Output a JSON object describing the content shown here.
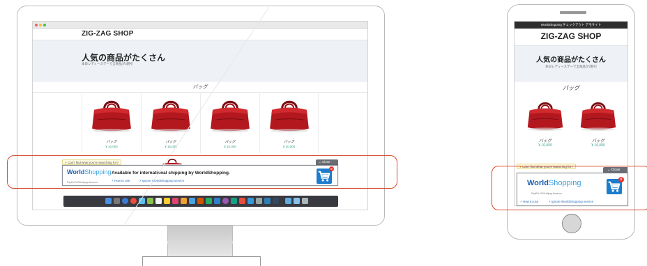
{
  "colors": {
    "highlight": "#d9462b",
    "price": "#35a08c",
    "cart": "#1b7ccd",
    "badge": "#e8312c",
    "link": "#2a6fb8",
    "bag": "#b3181f"
  },
  "desktop": {
    "shop_name": "ZIG-ZAG SHOP",
    "hero_title": "人気の商品がたくさん",
    "hero_sub": "本日レディースデーで全商品が3割引",
    "section_title": "バッグ",
    "products": [
      {
        "name": "バッグ",
        "price": "¥ 10,000"
      },
      {
        "name": "バッグ",
        "price": "¥ 15,000"
      },
      {
        "name": "バッグ",
        "price": "¥ 10,000"
      },
      {
        "name": "バッグ",
        "price": "¥ 10,000"
      }
    ],
    "widget": {
      "cant_find": "Can't find what you're searching for?",
      "close": "Close",
      "logo_world": "World",
      "logo_shopping": "Shopping",
      "payments": "PayPal  VISA  Alipay  Amazon",
      "message": "Available for international shipping by WorldShopping.",
      "how_to_use": "How to use",
      "ignore": "Ignore WorldShopping service",
      "badge": "0"
    }
  },
  "phone": {
    "top_bar": "Worldshopping チェックアウト デモサイト",
    "shop_name": "ZIG-ZAG SHOP",
    "hero_title": "人気の商品がたくさん",
    "hero_sub": "本日レディースデーで全商品が3割引",
    "section_title": "バッグ",
    "products": [
      {
        "name": "バッグ",
        "price": "¥ 10,000"
      },
      {
        "name": "バッグ",
        "price": "¥ 10,000"
      }
    ],
    "widget": {
      "cant_find": "Can't find what you're searching for?",
      "close": "Close",
      "logo_world": "World",
      "logo_shopping": "Shopping",
      "payments": "PayPal  VISA  Alipay  Amazon",
      "how_to_use": "How to use",
      "ignore": "Ignore WorldShopping service",
      "badge": "0"
    }
  }
}
